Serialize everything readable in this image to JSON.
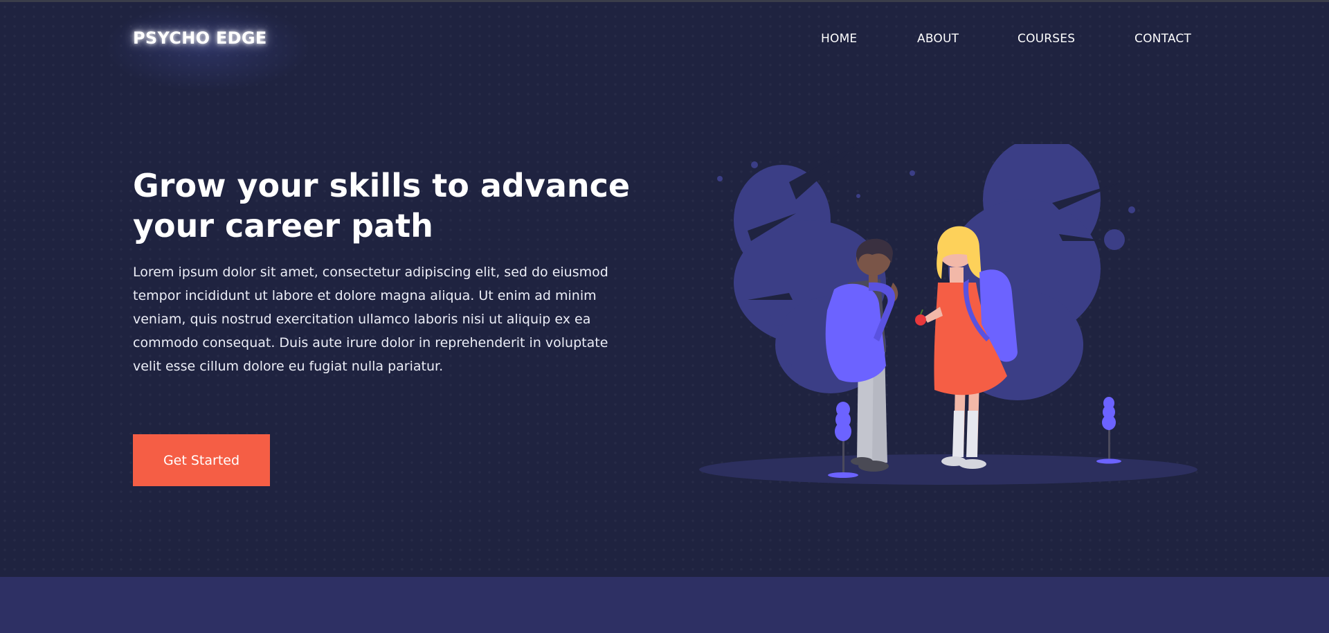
{
  "brand": {
    "logo_text": "PSYCHO EDGE"
  },
  "nav": {
    "items": [
      {
        "label": "HOME"
      },
      {
        "label": "ABOUT"
      },
      {
        "label": "COURSES"
      },
      {
        "label": "CONTACT"
      }
    ]
  },
  "hero": {
    "headline_line1": "Grow your skills to advance",
    "headline_line2": "your career path",
    "description": "Lorem ipsum dolor sit amet, consectetur adipiscing elit, sed do eiusmod tempor incididunt ut labore et dolore magna aliqua. Ut enim ad minim veniam, quis nostrud exercitation ullamco laboris nisi ut aliquip ex ea commodo consequat. Duis aute irure dolor in reprehenderit in voluptate velit esse cillum dolore eu fugiat nulla pariatur.",
    "cta_label": "Get Started"
  },
  "colors": {
    "background": "#1f2340",
    "accent": "#f55e45",
    "illustration_primary": "#6c63ff",
    "footer_band": "#2e3064"
  }
}
